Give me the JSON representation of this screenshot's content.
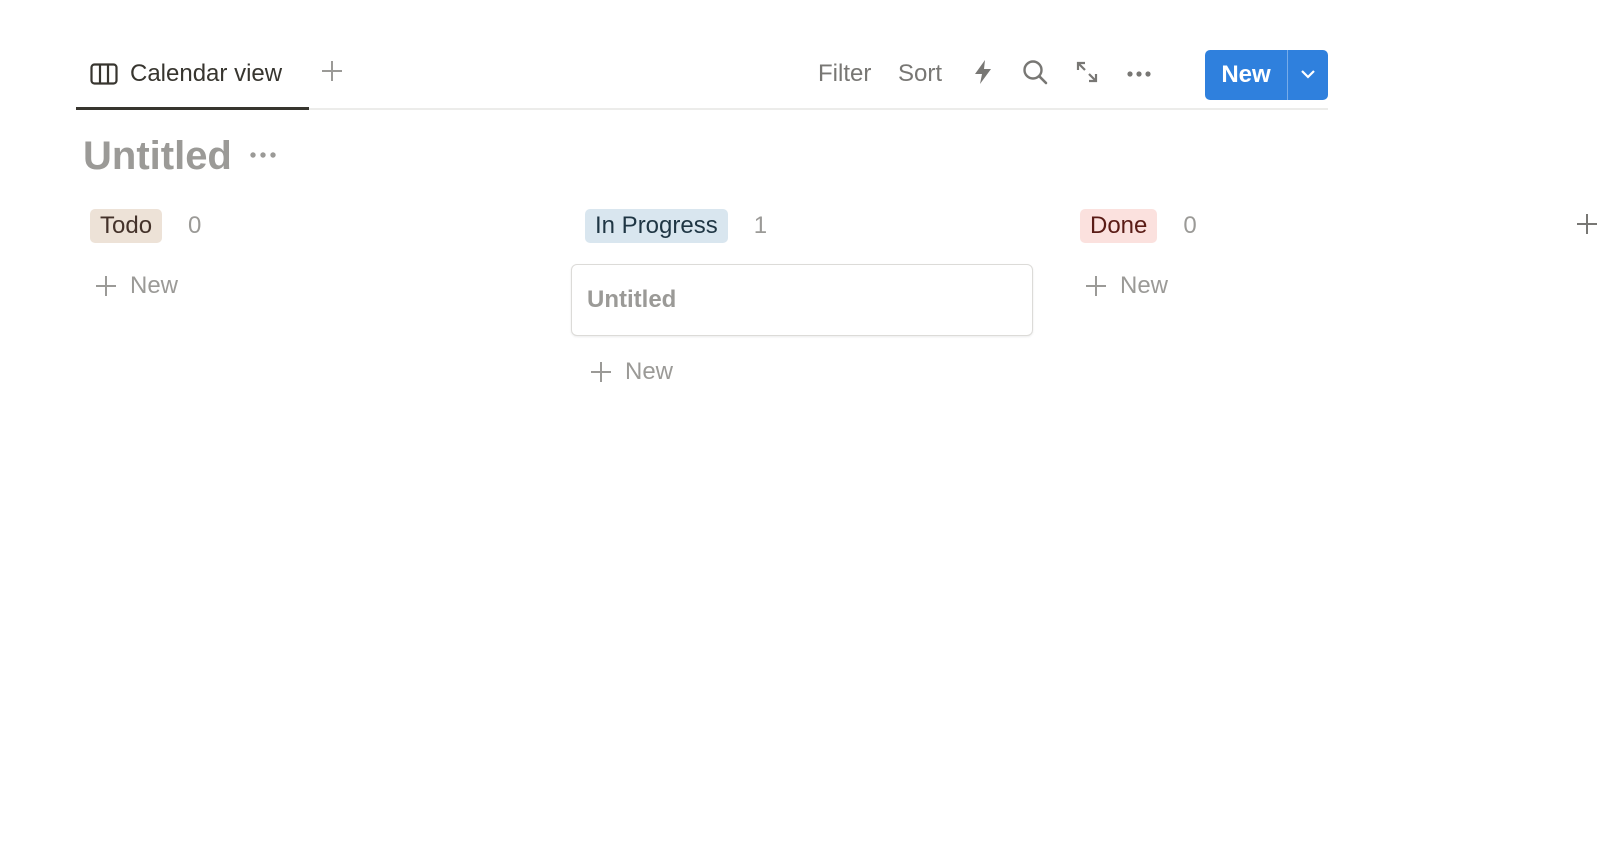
{
  "view_bar": {
    "active_tab": {
      "label": "Calendar view",
      "icon": "board-columns-icon"
    },
    "add_view_icon": "plus-icon",
    "filter_label": "Filter",
    "sort_label": "Sort",
    "automation_icon": "lightning-icon",
    "search_icon": "search-icon",
    "expand_icon": "expand-arrows-icon",
    "more_icon": "more-horizontal-icon",
    "new_button": {
      "label": "New",
      "dropdown_icon": "chevron-down-icon"
    }
  },
  "database": {
    "title": "Untitled",
    "more_icon": "more-horizontal-icon"
  },
  "board": {
    "columns": [
      {
        "name": "Todo",
        "count": "0",
        "tag_bg": "#ede2d7",
        "tag_color": "#44322a",
        "cards": [],
        "add_label": "New"
      },
      {
        "name": "In Progress",
        "count": "1",
        "tag_bg": "#d9e6ef",
        "tag_color": "#1f3644",
        "cards": [
          {
            "title": "Untitled"
          }
        ],
        "add_label": "New"
      },
      {
        "name": "Done",
        "count": "0",
        "tag_bg": "#fbe1de",
        "tag_color": "#5a1c16",
        "cards": [],
        "add_label": "New"
      }
    ],
    "add_group_icon": "plus-icon"
  },
  "colors": {
    "accent": "#2f80dd",
    "text": "#37352f",
    "muted": "#9b9a97",
    "toolbar_text": "#787774"
  }
}
